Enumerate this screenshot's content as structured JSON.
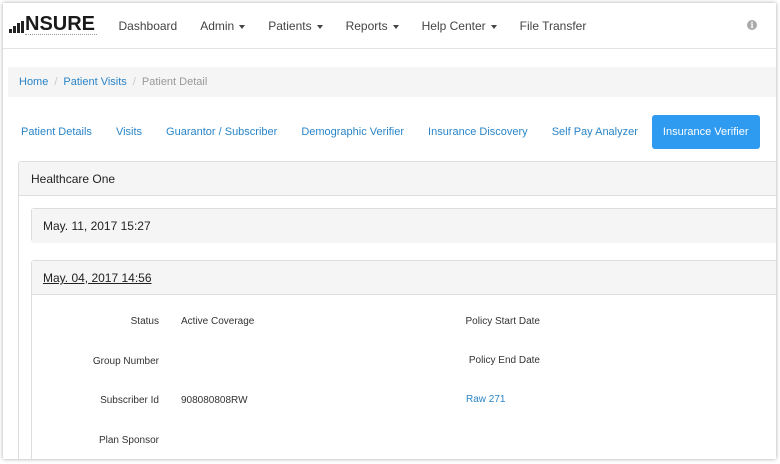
{
  "brand": {
    "name": "NSURE"
  },
  "nav": {
    "items": [
      {
        "label": "Dashboard",
        "dropdown": false
      },
      {
        "label": "Admin",
        "dropdown": true
      },
      {
        "label": "Patients",
        "dropdown": true
      },
      {
        "label": "Reports",
        "dropdown": true
      },
      {
        "label": "Help Center",
        "dropdown": true
      },
      {
        "label": "File Transfer",
        "dropdown": false
      }
    ],
    "info_icon": "info-circle-icon"
  },
  "breadcrumb": {
    "home": "Home",
    "patient_visits": "Patient Visits",
    "current": "Patient Detail"
  },
  "tabs": {
    "items": [
      "Patient Details",
      "Visits",
      "Guarantor / Subscriber",
      "Demographic Verifier",
      "Insurance Discovery",
      "Self Pay Analyzer",
      "Insurance Verifier"
    ],
    "active": "Insurance Verifier"
  },
  "panel": {
    "title": "Healthcare One",
    "entries": [
      {
        "date": "May. 11, 2017 15:27"
      },
      {
        "date": "May. 04, 2017 14:56"
      }
    ]
  },
  "details": {
    "status_label": "Status",
    "status_value": "Active Coverage",
    "group_number_label": "Group Number",
    "subscriber_id_label": "Subscriber Id",
    "subscriber_id_value": "908080808RW",
    "plan_sponsor_label": "Plan Sponsor",
    "policy_start_label": "Policy Start Date",
    "policy_end_label": "Policy End Date",
    "raw_link": "Raw 271"
  },
  "colors": {
    "accent": "#2e9af0",
    "link": "#2a85c7"
  }
}
